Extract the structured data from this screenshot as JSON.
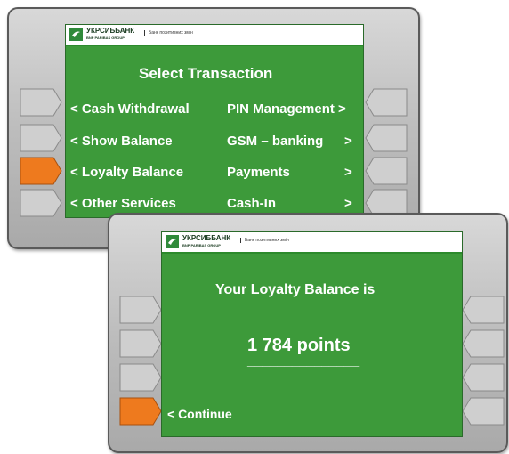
{
  "brand": {
    "bank_name": "УКРСИББАНК",
    "bank_sub": "BNP PARIBAS GROUP",
    "slogan": "Банк позитивних змін"
  },
  "menu_screen": {
    "title": "Select Transaction",
    "left_options": [
      "< Cash Withdrawal",
      "< Show  Balance",
      "< Loyalty Balance",
      "< Other Services"
    ],
    "right_options": [
      "PIN Management >",
      "GSM – banking",
      "Payments",
      "Cash-In"
    ],
    "right_arrows": [
      ">",
      ">",
      ">"
    ]
  },
  "balance_screen": {
    "heading": "Your Loyalty Balance is",
    "points": "1 784 points",
    "underline": "_______________",
    "continue": "< Continue"
  },
  "colors": {
    "screen_green": "#3d9a3a",
    "key_orange": "#ee7a1e",
    "key_grey": "#cfcfcf"
  }
}
